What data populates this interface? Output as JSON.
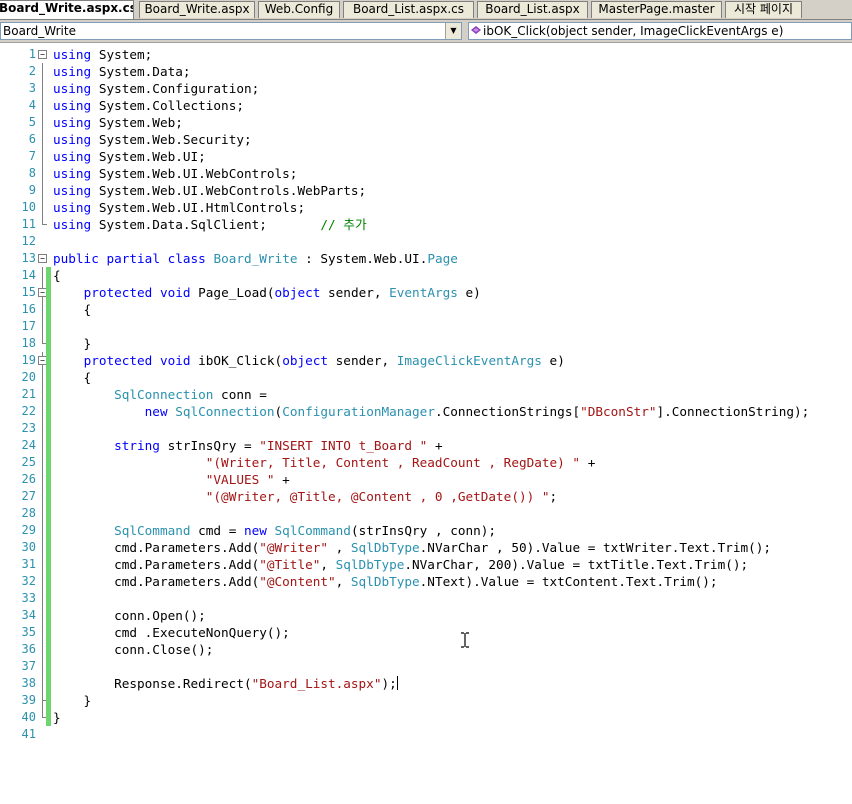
{
  "tabs": [
    {
      "label": "Board_Write.aspx.cs",
      "active": true
    },
    {
      "label": "Board_Write.aspx",
      "active": false
    },
    {
      "label": "Web.Config",
      "active": false
    },
    {
      "label": "Board_List.aspx.cs",
      "active": false
    },
    {
      "label": "Board_List.aspx",
      "active": false
    },
    {
      "label": "MasterPage.master",
      "active": false
    },
    {
      "label": "시작 페이지",
      "active": false
    }
  ],
  "nav": {
    "class_combo": "Board_Write",
    "member_combo": "ibOK_Click(object sender, ImageClickEventArgs e)"
  },
  "colors": {
    "keyword": "#0000ff",
    "type": "#2b91af",
    "string": "#a31515",
    "comment": "#008000",
    "line_number": "#2b91af",
    "change_bar": "#6fd66f"
  },
  "code_lines": [
    [
      [
        "kw",
        "using"
      ],
      [
        "t",
        " System;"
      ]
    ],
    [
      [
        "kw",
        "using"
      ],
      [
        "t",
        " System.Data;"
      ]
    ],
    [
      [
        "kw",
        "using"
      ],
      [
        "t",
        " System.Configuration;"
      ]
    ],
    [
      [
        "kw",
        "using"
      ],
      [
        "t",
        " System.Collections;"
      ]
    ],
    [
      [
        "kw",
        "using"
      ],
      [
        "t",
        " System.Web;"
      ]
    ],
    [
      [
        "kw",
        "using"
      ],
      [
        "t",
        " System.Web.Security;"
      ]
    ],
    [
      [
        "kw",
        "using"
      ],
      [
        "t",
        " System.Web.UI;"
      ]
    ],
    [
      [
        "kw",
        "using"
      ],
      [
        "t",
        " System.Web.UI.WebControls;"
      ]
    ],
    [
      [
        "kw",
        "using"
      ],
      [
        "t",
        " System.Web.UI.WebControls.WebParts;"
      ]
    ],
    [
      [
        "kw",
        "using"
      ],
      [
        "t",
        " System.Web.UI.HtmlControls;"
      ]
    ],
    [
      [
        "kw",
        "using"
      ],
      [
        "t",
        " System.Data.SqlClient;       "
      ],
      [
        "cm",
        "// 추가"
      ]
    ],
    [],
    [
      [
        "kw",
        "public"
      ],
      [
        "t",
        " "
      ],
      [
        "kw",
        "partial"
      ],
      [
        "t",
        " "
      ],
      [
        "kw",
        "class"
      ],
      [
        "t",
        " "
      ],
      [
        "ty",
        "Board_Write"
      ],
      [
        "t",
        " : System.Web.UI."
      ],
      [
        "ty",
        "Page"
      ]
    ],
    [
      [
        "t",
        "{"
      ]
    ],
    [
      [
        "t",
        "    "
      ],
      [
        "kw",
        "protected"
      ],
      [
        "t",
        " "
      ],
      [
        "kw",
        "void"
      ],
      [
        "t",
        " Page_Load("
      ],
      [
        "kw",
        "object"
      ],
      [
        "t",
        " sender, "
      ],
      [
        "ty",
        "EventArgs"
      ],
      [
        "t",
        " e)"
      ]
    ],
    [
      [
        "t",
        "    {"
      ]
    ],
    [],
    [
      [
        "t",
        "    }"
      ]
    ],
    [
      [
        "t",
        "    "
      ],
      [
        "kw",
        "protected"
      ],
      [
        "t",
        " "
      ],
      [
        "kw",
        "void"
      ],
      [
        "t",
        " ibOK_Click("
      ],
      [
        "kw",
        "object"
      ],
      [
        "t",
        " sender, "
      ],
      [
        "ty",
        "ImageClickEventArgs"
      ],
      [
        "t",
        " e)"
      ]
    ],
    [
      [
        "t",
        "    {"
      ]
    ],
    [
      [
        "t",
        "        "
      ],
      [
        "ty",
        "SqlConnection"
      ],
      [
        "t",
        " conn ="
      ]
    ],
    [
      [
        "t",
        "            "
      ],
      [
        "kw",
        "new"
      ],
      [
        "t",
        " "
      ],
      [
        "ty",
        "SqlConnection"
      ],
      [
        "t",
        "("
      ],
      [
        "ty",
        "ConfigurationManager"
      ],
      [
        "t",
        ".ConnectionStrings["
      ],
      [
        "st",
        "\"DBconStr\""
      ],
      [
        "t",
        "].ConnectionString);"
      ]
    ],
    [],
    [
      [
        "t",
        "        "
      ],
      [
        "kw",
        "string"
      ],
      [
        "t",
        " strInsQry = "
      ],
      [
        "st",
        "\"INSERT INTO t_Board \""
      ],
      [
        "t",
        " +"
      ]
    ],
    [
      [
        "t",
        "                    "
      ],
      [
        "st",
        "\"(Writer, Title, Content , ReadCount , RegDate) \""
      ],
      [
        "t",
        " +"
      ]
    ],
    [
      [
        "t",
        "                    "
      ],
      [
        "st",
        "\"VALUES \""
      ],
      [
        "t",
        " +"
      ]
    ],
    [
      [
        "t",
        "                    "
      ],
      [
        "st",
        "\"(@Writer, @Title, @Content , 0 ,GetDate()) \""
      ],
      [
        "t",
        ";"
      ]
    ],
    [],
    [
      [
        "t",
        "        "
      ],
      [
        "ty",
        "SqlCommand"
      ],
      [
        "t",
        " cmd = "
      ],
      [
        "kw",
        "new"
      ],
      [
        "t",
        " "
      ],
      [
        "ty",
        "SqlCommand"
      ],
      [
        "t",
        "(strInsQry , conn);"
      ]
    ],
    [
      [
        "t",
        "        cmd.Parameters.Add("
      ],
      [
        "st",
        "\"@Writer\""
      ],
      [
        "t",
        " , "
      ],
      [
        "ty",
        "SqlDbType"
      ],
      [
        "t",
        ".NVarChar , 50).Value = txtWriter.Text.Trim();"
      ]
    ],
    [
      [
        "t",
        "        cmd.Parameters.Add("
      ],
      [
        "st",
        "\"@Title\""
      ],
      [
        "t",
        ", "
      ],
      [
        "ty",
        "SqlDbType"
      ],
      [
        "t",
        ".NVarChar, 200).Value = txtTitle.Text.Trim();"
      ]
    ],
    [
      [
        "t",
        "        cmd.Parameters.Add("
      ],
      [
        "st",
        "\"@Content\""
      ],
      [
        "t",
        ", "
      ],
      [
        "ty",
        "SqlDbType"
      ],
      [
        "t",
        ".NText).Value = txtContent.Text.Trim();"
      ]
    ],
    [],
    [
      [
        "t",
        "        conn.Open();"
      ]
    ],
    [
      [
        "t",
        "        cmd .ExecuteNonQuery();"
      ]
    ],
    [
      [
        "t",
        "        conn.Close();"
      ]
    ],
    [],
    [
      [
        "t",
        "        Response.Redirect("
      ],
      [
        "st",
        "\"Board_List.aspx\""
      ],
      [
        "t",
        ");"
      ]
    ],
    [
      [
        "t",
        "    }"
      ]
    ],
    [
      [
        "t",
        "}"
      ]
    ],
    []
  ]
}
